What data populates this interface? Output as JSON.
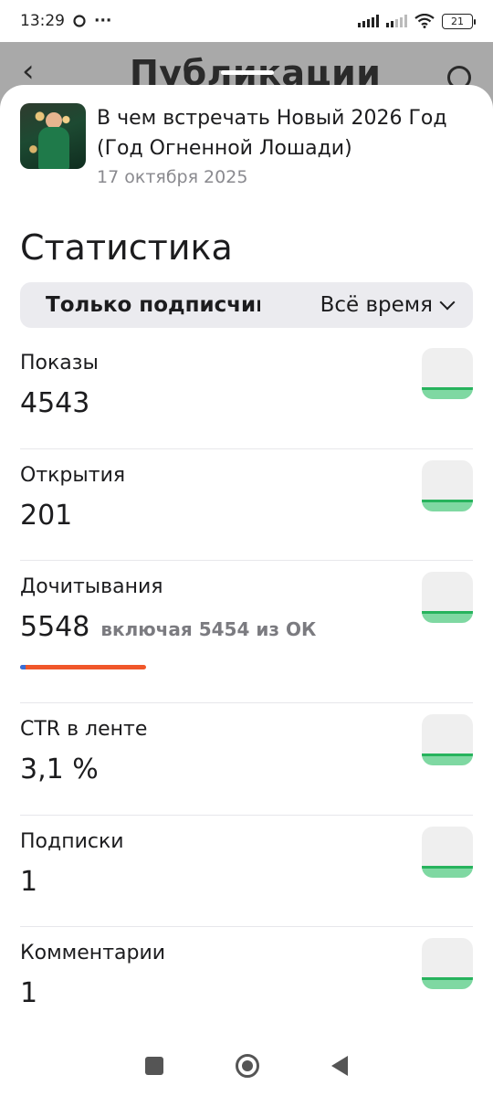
{
  "status_bar": {
    "time": "13:29",
    "left_icons": [
      "chat-bubble-icon",
      "more-dots-icon"
    ],
    "right_icons": [
      "signal-icon",
      "signal-icon",
      "wifi-icon",
      "battery-icon"
    ],
    "battery": "21",
    "dots": "···"
  },
  "behind": {
    "title": "Публикации",
    "back_icon": "‹"
  },
  "publication": {
    "title": "В чем встречать Новый 2026 Год (Год Огненной Лошади)",
    "date": "17 октября 2025"
  },
  "stats": {
    "title": "Статистика",
    "filter_audience": "Только подписчики",
    "filter_period": "Всё время"
  },
  "metrics": [
    {
      "label": "Показы",
      "value": "4543",
      "note": "",
      "progress": null
    },
    {
      "label": "Открытия",
      "value": "201",
      "note": "",
      "progress": null
    },
    {
      "label": "Дочитывания",
      "value": "5548",
      "note": "включая 5454 из ОК",
      "progress": 1.0
    },
    {
      "label": "CTR в ленте",
      "value": "3,1 %",
      "note": "",
      "progress": null
    },
    {
      "label": "Подписки",
      "value": "1",
      "note": "",
      "progress": null
    },
    {
      "label": "Комментарии",
      "value": "1",
      "note": "",
      "progress": null
    }
  ],
  "colors": {
    "accent_progress": "#f0572a",
    "sparkline": "#27b35d"
  }
}
